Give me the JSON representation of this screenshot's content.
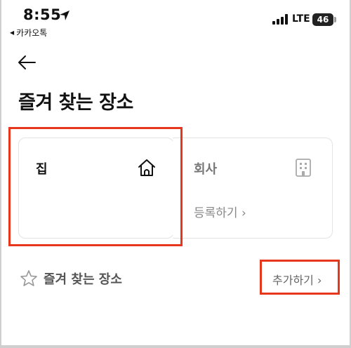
{
  "status_bar": {
    "time": "8:55",
    "back_app_label": "카카오톡",
    "network": "LTE",
    "battery": "46"
  },
  "header": {
    "title": "즐겨 찾는 장소"
  },
  "places": {
    "home": {
      "label": "집"
    },
    "work": {
      "label": "회사",
      "register_label": "등록하기 ›"
    }
  },
  "favorites": {
    "label": "즐겨 찾는 장소",
    "add_label": "추가하기 ›"
  },
  "colors": {
    "highlight": "#e6361c",
    "card_border": "#e3e3e3",
    "muted_text": "#888888"
  },
  "icons": [
    "location-arrow-icon",
    "signal-icon",
    "back-arrow-icon",
    "home-icon",
    "building-icon",
    "star-icon"
  ]
}
